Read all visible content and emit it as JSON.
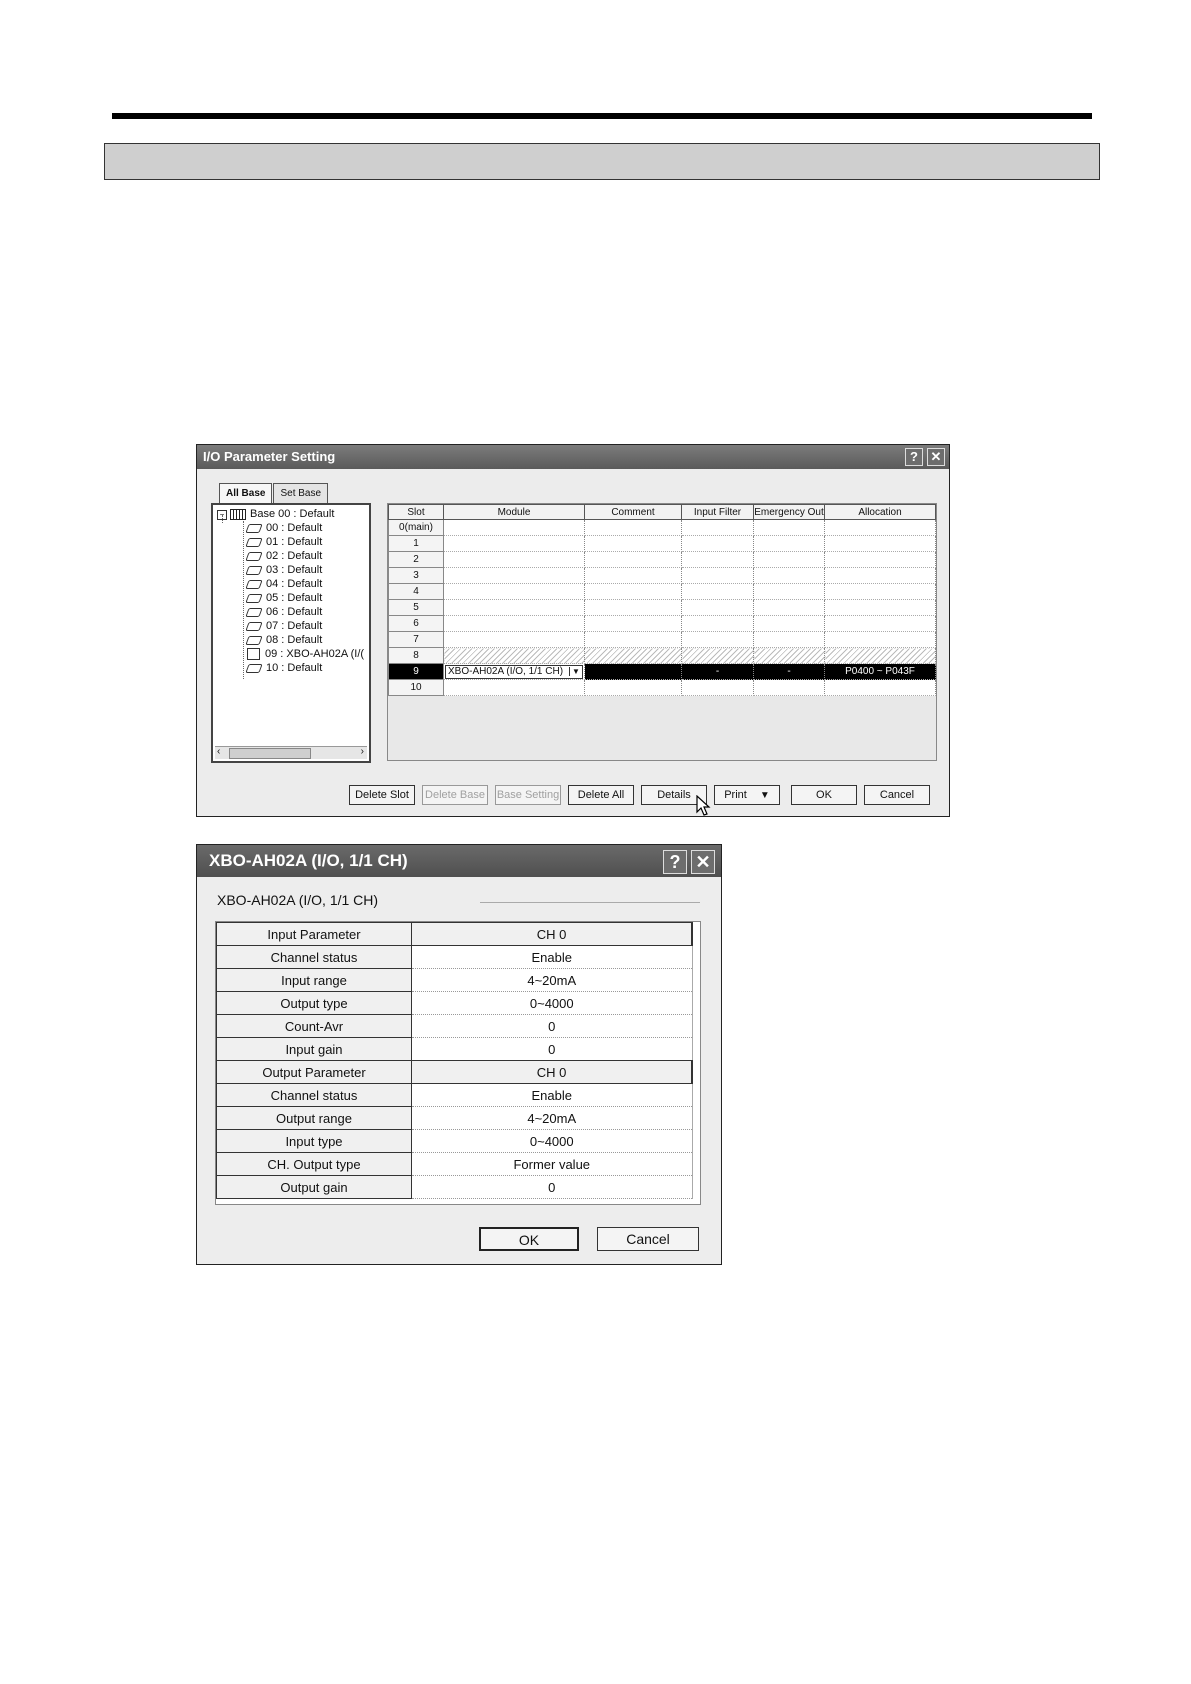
{
  "io_window": {
    "title": "I/O Parameter Setting",
    "help_glyph": "?",
    "close_glyph": "✕",
    "tabs": [
      "All Base",
      "Set Base"
    ],
    "tree": {
      "root": "Base 00 : Default",
      "items": [
        "00 : Default",
        "01 : Default",
        "02 : Default",
        "03 : Default",
        "04 : Default",
        "05 : Default",
        "06 : Default",
        "07 : Default",
        "08 : Default",
        "09 : XBO-AH02A (I/(",
        "10 : Default"
      ]
    },
    "grid": {
      "headers": [
        "Slot",
        "Module",
        "Comment",
        "Input Filter",
        "Emergency Out",
        "Allocation"
      ],
      "slots": [
        "0(main)",
        "1",
        "2",
        "3",
        "4",
        "5",
        "6",
        "7",
        "8",
        "9",
        "10"
      ],
      "selected_module": "XBO-AH02A (I/O, 1/1 CH)",
      "selected_input_filter": "-",
      "selected_emergency_out": "-",
      "selected_allocation": "P0400 ~ P043F"
    },
    "buttons": {
      "delete_slot": "Delete Slot",
      "delete_base": "Delete Base",
      "base_setting": "Base Setting",
      "delete_all": "Delete All",
      "details": "Details",
      "print": "Print",
      "print_arrow": "▼",
      "ok": "OK",
      "cancel": "Cancel"
    }
  },
  "detail_window": {
    "title": "XBO-AH02A (I/O, 1/1 CH)",
    "help_glyph": "?",
    "close_glyph": "✕",
    "subtitle": "XBO-AH02A (I/O, 1/1 CH)",
    "rows": [
      {
        "label": "Input Parameter",
        "value": "CH 0"
      },
      {
        "label": "Channel status",
        "value": "Enable"
      },
      {
        "label": "Input range",
        "value": "4~20mA"
      },
      {
        "label": "Output type",
        "value": "0~4000"
      },
      {
        "label": "Count-Avr",
        "value": "0"
      },
      {
        "label": "Input gain",
        "value": "0"
      },
      {
        "label": "Output Parameter",
        "value": "CH 0"
      },
      {
        "label": "Channel status",
        "value": "Enable"
      },
      {
        "label": "Output range",
        "value": "4~20mA"
      },
      {
        "label": "Input type",
        "value": "0~4000"
      },
      {
        "label": "CH. Output type",
        "value": "Former value"
      },
      {
        "label": "Output gain",
        "value": "0"
      }
    ],
    "buttons": {
      "ok": "OK",
      "cancel": "Cancel"
    }
  }
}
